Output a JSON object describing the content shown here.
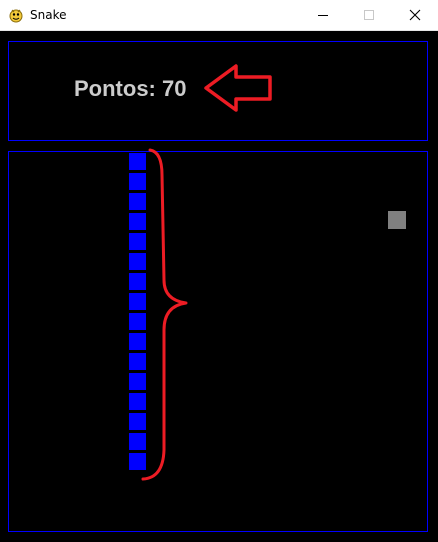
{
  "window": {
    "title": "Snake",
    "icon": "pygame-snake-icon"
  },
  "hud": {
    "score_text": "Pontos: 70"
  },
  "game": {
    "snake_length": 16,
    "snake_color": "#0000ff",
    "food_color": "#808080",
    "border_color": "#0000ff",
    "background_color": "#000000",
    "text_color": "#cccccc"
  },
  "annotations": {
    "color": "#ed1c24",
    "arrow_icon": "left-arrow-icon",
    "brace_icon": "curly-brace-icon"
  }
}
